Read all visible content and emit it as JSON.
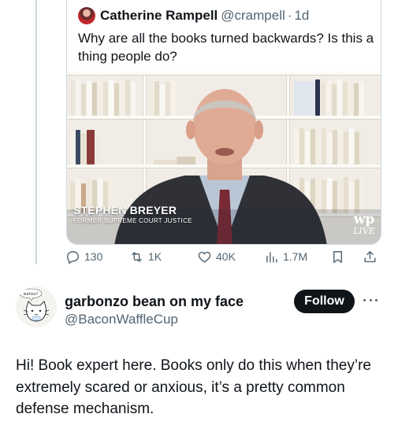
{
  "quoted_tweet": {
    "author_name": "Catherine Rampell",
    "handle": "@crampell",
    "separator": "·",
    "time": "1d",
    "text": "Why are all the books turned backwards? Is this a thing people do?",
    "video": {
      "lower_third_name": "STEPHEN BREYER",
      "lower_third_title": "FORMER SUPREME COURT JUSTICE",
      "logo_mark": "wp",
      "logo_label": "LIVE"
    }
  },
  "actions": {
    "replies": "130",
    "reposts": "1K",
    "likes": "40K",
    "views": "1.7M"
  },
  "reply": {
    "display_name": "garbonzo bean on my face",
    "handle": "@BaconWaffleCup",
    "follow_label": "Follow",
    "text": "Hi! Book expert here. Books only do this when they’re extremely scared or anxious, it’s a pretty common defense mechanism.",
    "avatar_bubble_text": "wahoo?"
  },
  "colors": {
    "text_primary": "#0f1419",
    "text_secondary": "#536471",
    "border": "#cfd9de",
    "follow_bg": "#0f1419"
  },
  "icons": [
    "reply-icon",
    "repost-icon",
    "like-icon",
    "views-icon",
    "bookmark-icon",
    "share-icon",
    "more-icon"
  ]
}
